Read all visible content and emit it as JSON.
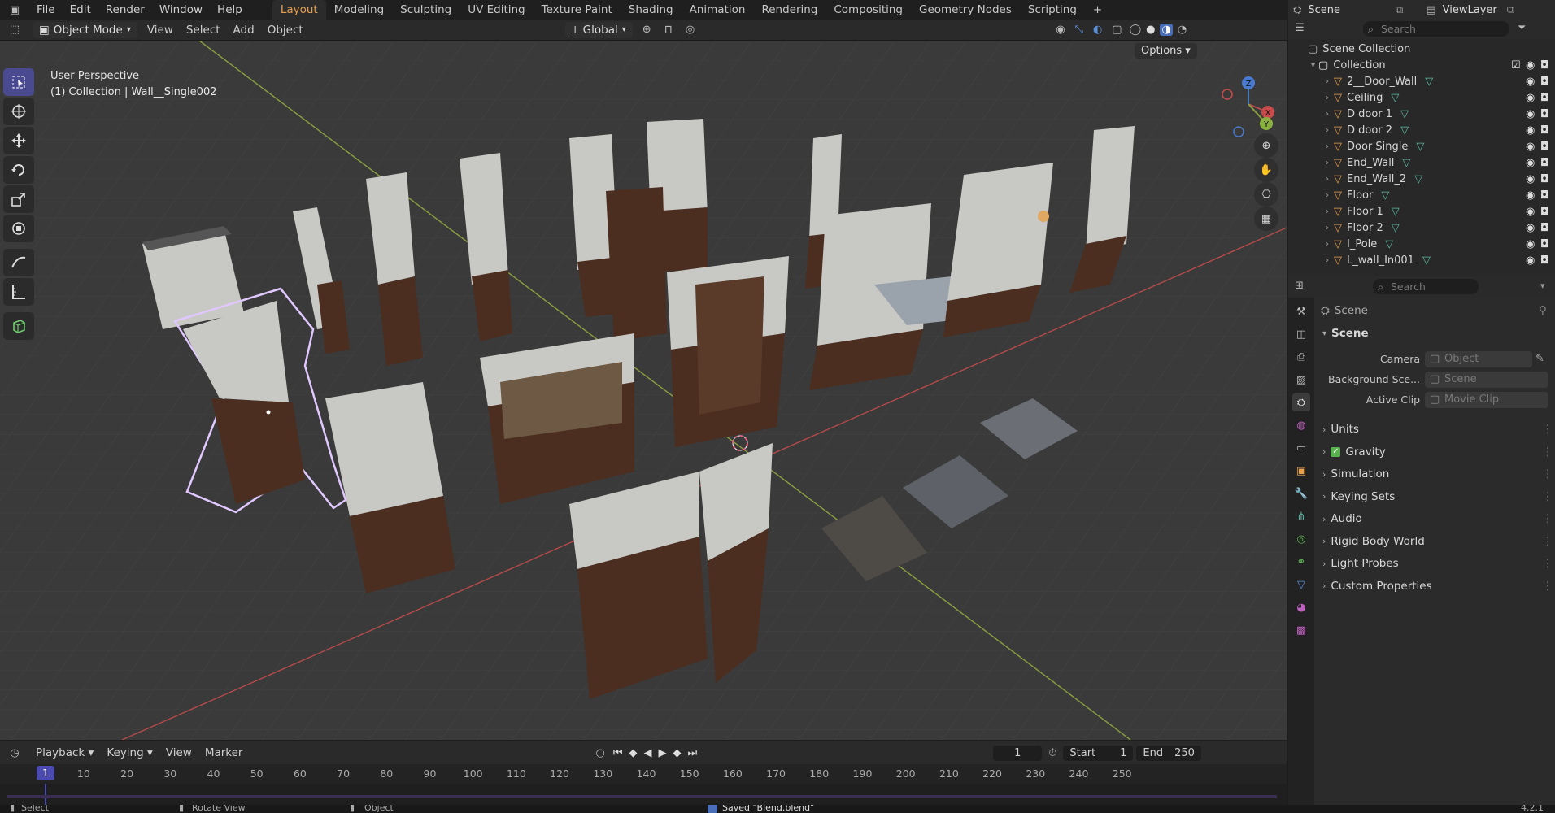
{
  "menu": {
    "items": [
      "File",
      "Edit",
      "Render",
      "Window",
      "Help"
    ],
    "workspaces": [
      "Layout",
      "Modeling",
      "Sculpting",
      "UV Editing",
      "Texture Paint",
      "Shading",
      "Animation",
      "Rendering",
      "Compositing",
      "Geometry Nodes",
      "Scripting"
    ],
    "active_workspace": "Layout",
    "add_tab": "+",
    "scene_label": "Scene",
    "viewlayer_label": "ViewLayer"
  },
  "viewport_header": {
    "mode": "Object Mode",
    "menus": [
      "View",
      "Select",
      "Add",
      "Object"
    ],
    "orientation": "Global",
    "options": "Options"
  },
  "viewport": {
    "perspective": "User Perspective",
    "selection_info": "(1) Collection | Wall__Single002",
    "gizmo_axes": [
      "X",
      "Y",
      "Z"
    ],
    "colors": {
      "background": "#3a3a3a",
      "selection": "#e0c8ff",
      "x_axis": "#b24a4a",
      "y_axis": "#8aa040"
    }
  },
  "tools": [
    "select-box-icon",
    "cursor-icon",
    "move-icon",
    "rotate-icon",
    "scale-icon",
    "transform-icon",
    "annotate-icon",
    "measure-icon",
    "add-cube-icon"
  ],
  "outliner": {
    "search_placeholder": "Search",
    "root": "Scene Collection",
    "collection": "Collection",
    "objects": [
      "2__Door_Wall",
      "Ceiling",
      "D door 1",
      "D door 2",
      "Door Single",
      "End_Wall",
      "End_Wall_2",
      "Floor",
      "Floor 1",
      "Floor 2",
      "I_Pole",
      "L_wall_In001"
    ]
  },
  "properties": {
    "search_placeholder": "Search",
    "breadcrumb": "Scene",
    "panel_title": "Scene",
    "fields": [
      {
        "label": "Camera",
        "value": "Object"
      },
      {
        "label": "Background Sce...",
        "value": "Scene"
      },
      {
        "label": "Active Clip",
        "value": "Movie Clip"
      }
    ],
    "subpanels": [
      "Units",
      "Gravity",
      "Simulation",
      "Keying Sets",
      "Audio",
      "Rigid Body World",
      "Light Probes",
      "Custom Properties"
    ],
    "gravity_checked": true
  },
  "timeline": {
    "menus": [
      "Playback",
      "Keying",
      "View",
      "Marker"
    ],
    "current_frame": "1",
    "start_label": "Start",
    "start": "1",
    "end_label": "End",
    "end": "250",
    "ruler_ticks": [
      "1",
      "10",
      "20",
      "30",
      "40",
      "50",
      "60",
      "70",
      "80",
      "90",
      "100",
      "110",
      "120",
      "130",
      "140",
      "150",
      "160",
      "170",
      "180",
      "190",
      "200",
      "210",
      "220",
      "230",
      "240",
      "250"
    ]
  },
  "status_bar": {
    "select": "Select",
    "rotate": "Rotate View",
    "object": "Object",
    "message": "Saved \"Blend.blend\"",
    "version": "4.2.1"
  }
}
